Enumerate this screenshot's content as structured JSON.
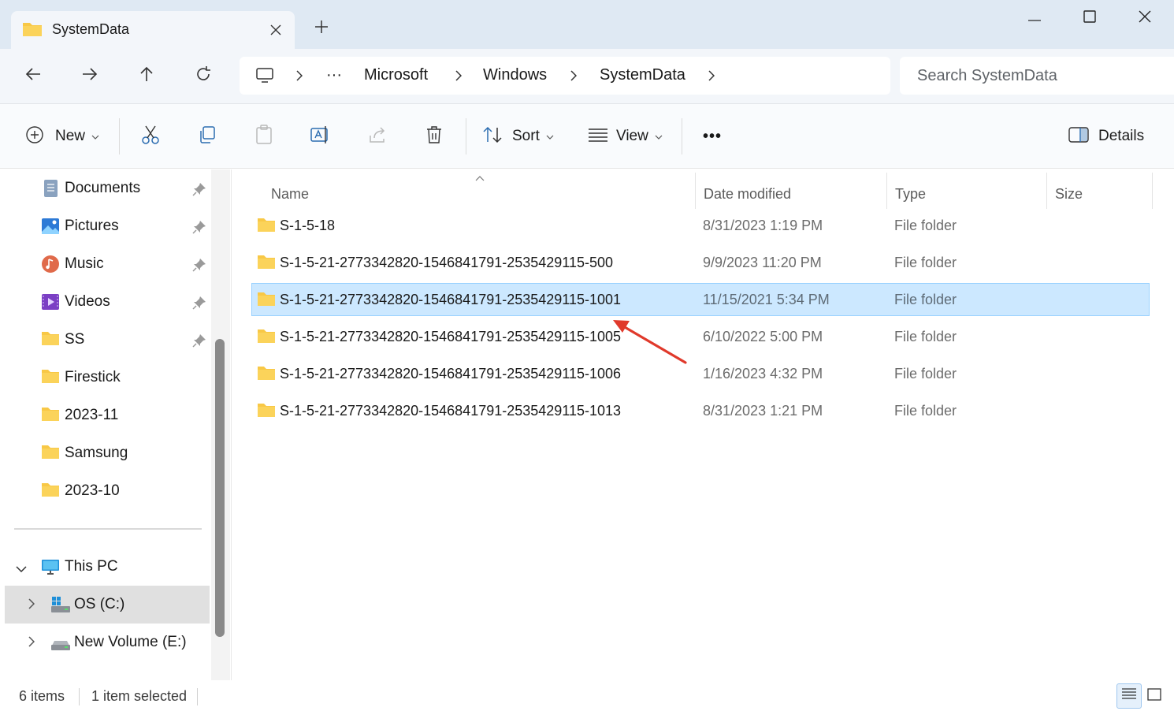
{
  "window": {
    "tab_title": "SystemData",
    "tab_close_icon": "close-icon",
    "new_tab_icon": "plus-icon",
    "minimize_icon": "minimize-icon",
    "maximize_icon": "maximize-icon",
    "close_icon": "close-icon"
  },
  "nav": {
    "back_icon": "arrow-left-icon",
    "forward_icon": "arrow-right-icon",
    "up_icon": "arrow-up-icon",
    "refresh_icon": "refresh-icon"
  },
  "address": {
    "ellipsis": "···",
    "crumbs": [
      "Microsoft",
      "Windows",
      "SystemData"
    ]
  },
  "search": {
    "placeholder": "Search SystemData"
  },
  "commandbar": {
    "new_label": "New",
    "sort_label": "Sort",
    "view_label": "View",
    "more_label": "•••",
    "details_label": "Details"
  },
  "sidebar": {
    "quick_access": [
      {
        "label": "Documents",
        "icon": "documents-icon",
        "pinned": true
      },
      {
        "label": "Pictures",
        "icon": "pictures-icon",
        "pinned": true
      },
      {
        "label": "Music",
        "icon": "music-icon",
        "pinned": true
      },
      {
        "label": "Videos",
        "icon": "videos-icon",
        "pinned": true
      },
      {
        "label": "SS",
        "icon": "folder-icon",
        "pinned": true
      },
      {
        "label": "Firestick",
        "icon": "folder-icon",
        "pinned": false
      },
      {
        "label": "2023-11",
        "icon": "folder-icon",
        "pinned": false
      },
      {
        "label": "Samsung",
        "icon": "folder-icon",
        "pinned": false
      },
      {
        "label": "2023-10",
        "icon": "folder-icon",
        "pinned": false
      }
    ],
    "this_pc": "This PC",
    "drives": [
      {
        "label": "OS (C:)",
        "icon": "system-drive-icon",
        "selected": true
      },
      {
        "label": "New Volume (E:)",
        "icon": "drive-icon",
        "selected": false
      }
    ]
  },
  "columns": {
    "name": "Name",
    "date": "Date modified",
    "type": "Type",
    "size": "Size"
  },
  "files": [
    {
      "name": "S-1-5-18",
      "date": "8/31/2023 1:19 PM",
      "type": "File folder",
      "selected": false
    },
    {
      "name": "S-1-5-21-2773342820-1546841791-2535429115-500",
      "date": "9/9/2023 11:20 PM",
      "type": "File folder",
      "selected": false
    },
    {
      "name": "S-1-5-21-2773342820-1546841791-2535429115-1001",
      "date": "11/15/2021 5:34 PM",
      "type": "File folder",
      "selected": true
    },
    {
      "name": "S-1-5-21-2773342820-1546841791-2535429115-1005",
      "date": "6/10/2022 5:00 PM",
      "type": "File folder",
      "selected": false
    },
    {
      "name": "S-1-5-21-2773342820-1546841791-2535429115-1006",
      "date": "1/16/2023 4:32 PM",
      "type": "File folder",
      "selected": false
    },
    {
      "name": "S-1-5-21-2773342820-1546841791-2535429115-1013",
      "date": "8/31/2023 1:21 PM",
      "type": "File folder",
      "selected": false
    }
  ],
  "status": {
    "items": "6 items",
    "selected": "1 item selected"
  },
  "colors": {
    "folder": "#f8c846",
    "selection": "#cce8ff",
    "annotation_arrow": "#e0392b"
  }
}
